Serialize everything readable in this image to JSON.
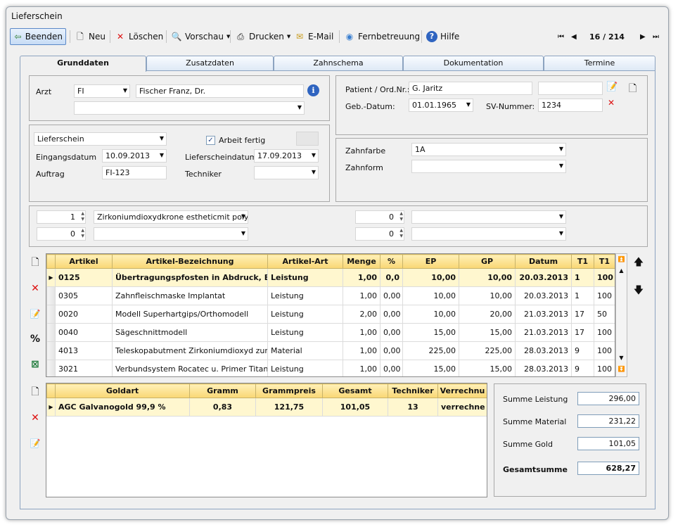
{
  "window": {
    "title": "Lieferschein"
  },
  "toolbar": {
    "beenden": "Beenden",
    "neu": "Neu",
    "loeschen": "Löschen",
    "vorschau": "Vorschau",
    "drucken": "Drucken",
    "email": "E-Mail",
    "fernbetreuung": "Fernbetreuung",
    "hilfe": "Hilfe",
    "record": "16 / 214"
  },
  "tabs": [
    "Grunddaten",
    "Zusatzdaten",
    "Zahnschema",
    "Dokumentation",
    "Termine"
  ],
  "arzt": {
    "label": "Arzt",
    "code": "FI",
    "name": "Fischer Franz, Dr.",
    "second": ""
  },
  "patient": {
    "label": "Patient / Ord.Nr.:",
    "value": "G. Jaritz",
    "extra": "",
    "geb_label": "Geb.-Datum:",
    "geb_value": "01.01.1965",
    "sv_label": "SV-Nummer:",
    "sv_value": "1234"
  },
  "doc": {
    "type": "Lieferschein",
    "fertig_label": "Arbeit fertig",
    "eingang_label": "Eingangsdatum",
    "eingang_value": "10.09.2013",
    "liefer_label": "Lieferscheindatum",
    "liefer_value": "17.09.2013",
    "auftrag_label": "Auftrag",
    "auftrag_value": "FI-123",
    "techniker_label": "Techniker",
    "techniker_value": ""
  },
  "zahn": {
    "farbe_label": "Zahnfarbe",
    "farbe_value": "1A",
    "form_label": "Zahnform",
    "form_value": ""
  },
  "positions": [
    {
      "qty": "1",
      "item": "Zirkoniumdioxydkrone estheticmit poly",
      "qty2": "0",
      "item2": ""
    },
    {
      "qty": "0",
      "item": "",
      "qty2": "0",
      "item2": ""
    }
  ],
  "articles": {
    "headers": [
      "Artikel",
      "Artikel-Bezeichnung",
      "Artikel-Art",
      "Menge",
      "%",
      "EP",
      "GP",
      "Datum",
      "T1",
      "T1"
    ],
    "rows": [
      [
        "0125",
        "Übertragungspfosten in Abdruck, Bo",
        "Leistung",
        "1,00",
        "0,0",
        "10,00",
        "10,00",
        "20.03.2013",
        "1",
        "100"
      ],
      [
        "0305",
        "Zahnfleischmaske Implantat",
        "Leistung",
        "1,00",
        "0,00",
        "10,00",
        "10,00",
        "20.03.2013",
        "1",
        "100"
      ],
      [
        "0020",
        "Modell Superhartgips/Orthomodell",
        "Leistung",
        "2,00",
        "0,00",
        "10,00",
        "20,00",
        "21.03.2013",
        "17",
        "50"
      ],
      [
        "0040",
        "Sägeschnittmodell",
        "Leistung",
        "1,00",
        "0,00",
        "15,00",
        "15,00",
        "21.03.2013",
        "17",
        "100"
      ],
      [
        "4013",
        "Teleskopabutment Zirkoniumdioxyd zur Ve",
        "Material",
        "1,00",
        "0,00",
        "225,00",
        "225,00",
        "28.03.2013",
        "9",
        "100"
      ],
      [
        "3021",
        "Verbundsystem Rocatec u. Primer Titan/Zi",
        "Leistung",
        "1,00",
        "0,00",
        "15,00",
        "15,00",
        "28.03.2013",
        "9",
        "100"
      ]
    ]
  },
  "gold": {
    "headers": [
      "Goldart",
      "Gramm",
      "Grammpreis",
      "Gesamt",
      "Techniker",
      "Verrechnu"
    ],
    "rows": [
      [
        "AGC Galvanogold 99,9 %",
        "0,83",
        "121,75",
        "101,05",
        "13",
        "verrechne"
      ]
    ]
  },
  "sums": {
    "leistung_label": "Summe Leistung",
    "leistung": "296,00",
    "material_label": "Summe Material",
    "material": "231,22",
    "gold_label": "Summe Gold",
    "gold": "101,05",
    "gesamt_label": "Gesamtsumme",
    "gesamt": "628,27"
  }
}
